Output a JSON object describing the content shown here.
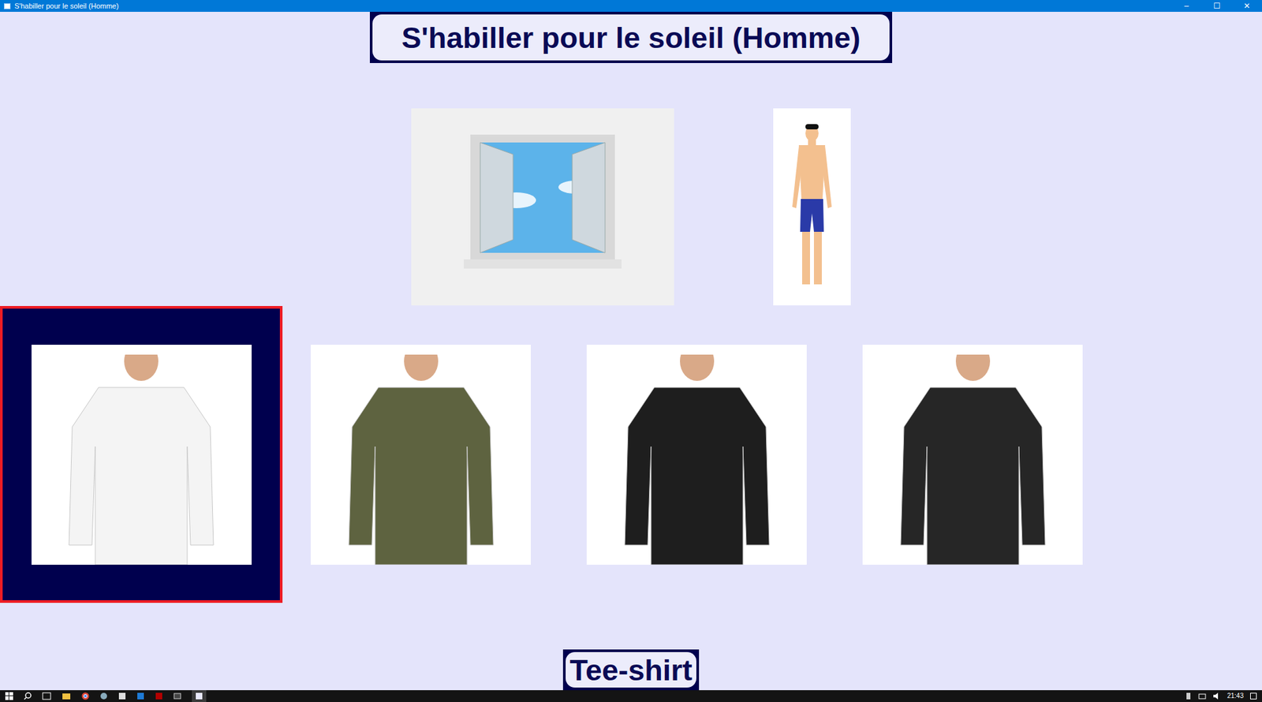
{
  "window": {
    "title": "S'habiller pour le soleil (Homme)",
    "controls": [
      "–",
      "☐",
      "✕"
    ]
  },
  "heading": "S'habiller pour le soleil (Homme)",
  "scene": {
    "weather": {
      "kind": "window"
    },
    "figure": {
      "kind": "figure"
    }
  },
  "clothes": [
    {
      "selected": true,
      "color": "#f4f4f4"
    },
    {
      "selected": false,
      "color": "#5e6340"
    },
    {
      "selected": false,
      "color": "#1e1e1e"
    },
    {
      "selected": false,
      "color": "#262626"
    }
  ],
  "caption": "Tee-shirt",
  "taskbar": {
    "clock": "21:43"
  }
}
